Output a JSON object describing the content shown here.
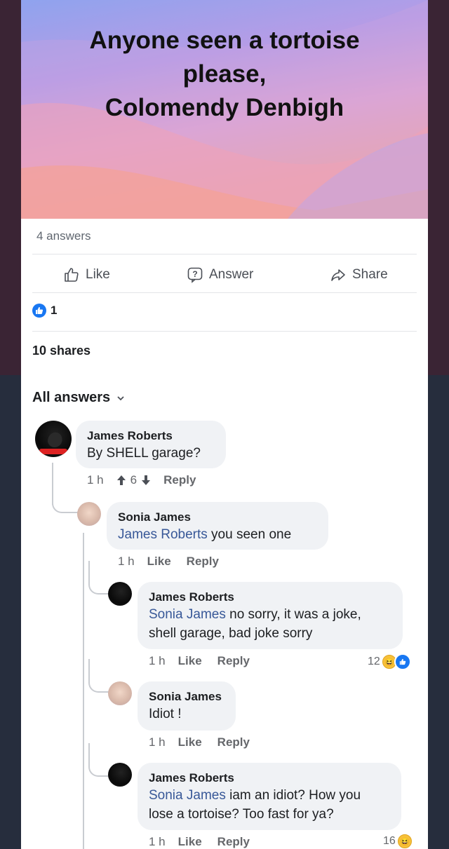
{
  "banner": {
    "title_lines": [
      "Anyone seen a tortoise",
      "please,",
      "Colomendy Denbigh"
    ]
  },
  "post": {
    "answers_count": "4 answers",
    "actions": {
      "like": "Like",
      "answer": "Answer",
      "share": "Share"
    },
    "reaction_count": "1",
    "shares": "10 shares"
  },
  "answers_header": {
    "label": "All answers"
  },
  "comments": [
    {
      "author": "James Roberts",
      "mention": "",
      "text": "By SHELL garage?",
      "time": "1 h",
      "upvotes": "6",
      "reply": "Reply"
    },
    {
      "author": "Sonia James",
      "mention": "James Roberts",
      "text": " you seen one",
      "time": "1 h",
      "like": "Like",
      "reply": "Reply"
    },
    {
      "author": "James Roberts",
      "mention": "Sonia James",
      "text_line1": " no sorry, it was a joke,",
      "text_line2": "shell garage, bad joke sorry",
      "time": "1 h",
      "like": "Like",
      "reply": "Reply",
      "reactions": "12"
    },
    {
      "author": "Sonia James",
      "mention": "",
      "text": "Idiot !",
      "time": "1 h",
      "like": "Like",
      "reply": "Reply"
    },
    {
      "author": "James Roberts",
      "mention": "Sonia James",
      "text_line1": " iam an idiot? How you",
      "text_line2": "lose a tortoise? Too fast for ya?",
      "time": "1 h",
      "like": "Like",
      "reply": "Reply",
      "reactions": "16"
    }
  ],
  "colors": {
    "accent": "#1877f2",
    "mention": "#385898",
    "bubble": "#f0f2f5"
  }
}
